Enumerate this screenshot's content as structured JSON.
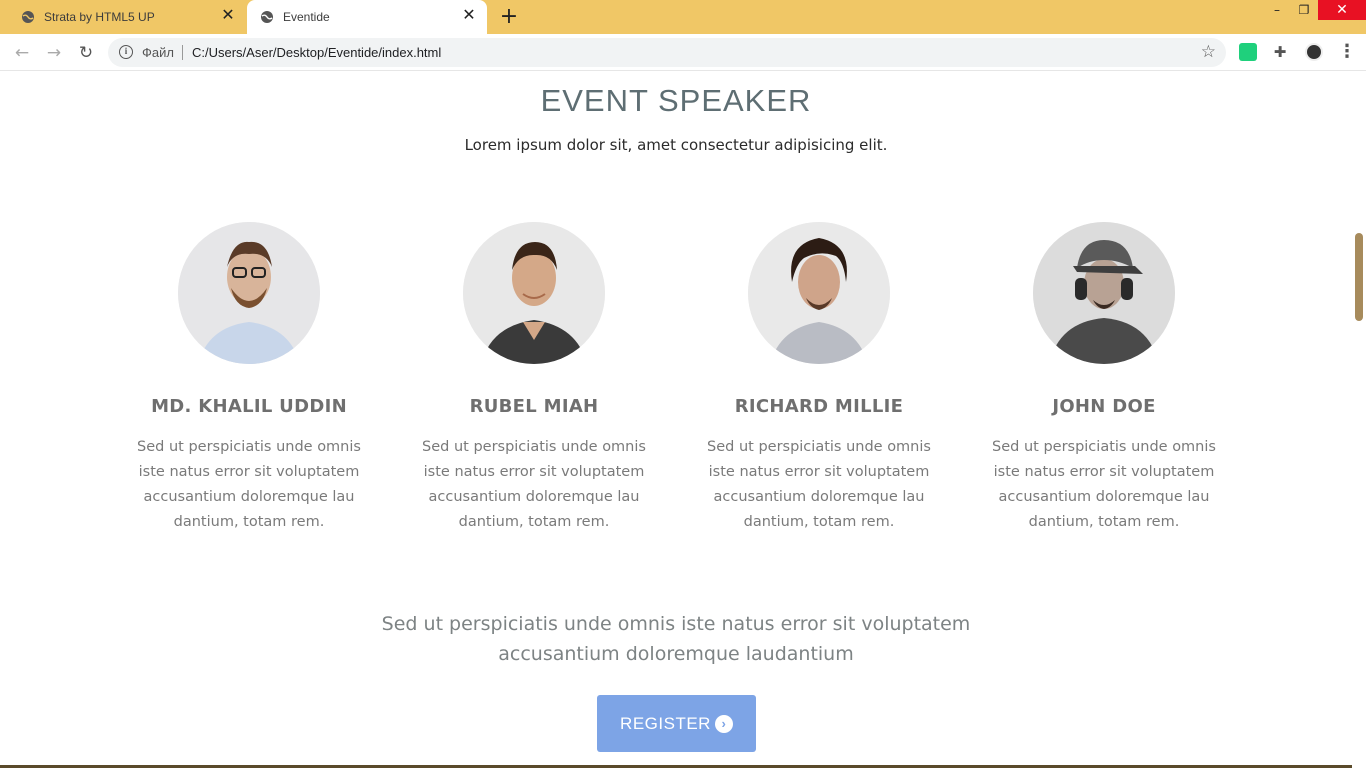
{
  "browser": {
    "tabs": [
      {
        "title": "Strata by HTML5 UP",
        "active": false
      },
      {
        "title": "Eventide",
        "active": true
      }
    ],
    "new_tab_label": "+",
    "window": {
      "minimize": "–",
      "maximize": "❐",
      "close": "✕"
    },
    "nav": {
      "back": "←",
      "forward": "→",
      "reload": "↻"
    },
    "address": {
      "scheme_label": "Файл",
      "url": "C:/Users/Aser/Desktop/Eventide/index.html",
      "bookmark_icon": "☆"
    },
    "extensions": [
      "green-extension-icon",
      "puzzle-icon",
      "profile-avatar-icon"
    ],
    "menu_label": "⋮",
    "colors": {
      "tabbar": "#f0c766",
      "close_button": "#e81123"
    }
  },
  "section": {
    "title": "EVENT SPEAKER",
    "subtitle": "Lorem ipsum dolor sit, amet consectetur adipisicing elit."
  },
  "speakers": [
    {
      "name": "MD. KHALIL UDDIN",
      "bio": "Sed ut perspiciatis unde omnis iste natus error sit voluptatem accusantium doloremque lau dantium, totam rem."
    },
    {
      "name": "RUBEL MIAH",
      "bio": "Sed ut perspiciatis unde omnis iste natus error sit voluptatem accusantium doloremque lau dantium, totam rem."
    },
    {
      "name": "RICHARD MILLIE",
      "bio": "Sed ut perspiciatis unde omnis iste natus error sit voluptatem accusantium doloremque lau dantium, totam rem."
    },
    {
      "name": "JOHN DOE",
      "bio": "Sed ut perspiciatis unde omnis iste natus error sit voluptatem accusantium doloremque lau dantium, totam rem."
    }
  ],
  "tagline": "Sed ut perspiciatis unde omnis iste natus error sit voluptatem accusantium doloremque laudantium",
  "register": {
    "label": "REGISTER",
    "icon": "chevron-right-circle-icon"
  },
  "colors": {
    "accent_button": "#7da4e6",
    "title_text": "#5e6e73",
    "scrollbar_thumb": "#a78b5c"
  }
}
